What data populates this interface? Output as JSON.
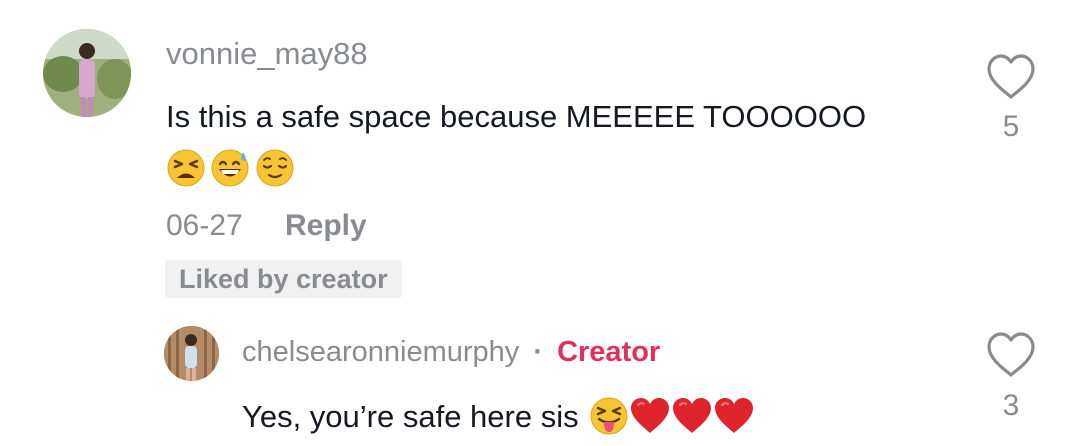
{
  "comment": {
    "username": "vonnie_may88",
    "text": "Is this a safe space because MEEEEE TOOOOOO",
    "emojis": [
      "tired-face",
      "grinning-sweat",
      "relieved-face"
    ],
    "date": "06-27",
    "reply_label": "Reply",
    "liked_badge": "Liked by creator",
    "like_count": "5"
  },
  "reply": {
    "username": "chelsearonniemurphy",
    "separator": "·",
    "creator_tag": "Creator",
    "text": "Yes, you’re safe here sis",
    "emojis": [
      "squinting-tongue-face",
      "red-heart",
      "red-heart",
      "red-heart"
    ],
    "like_count": "3"
  },
  "colors": {
    "accent_creator": "#e3305a",
    "secondary_text": "#8a8b91",
    "primary_text": "#161823",
    "badge_bg": "#f1f1f2"
  }
}
